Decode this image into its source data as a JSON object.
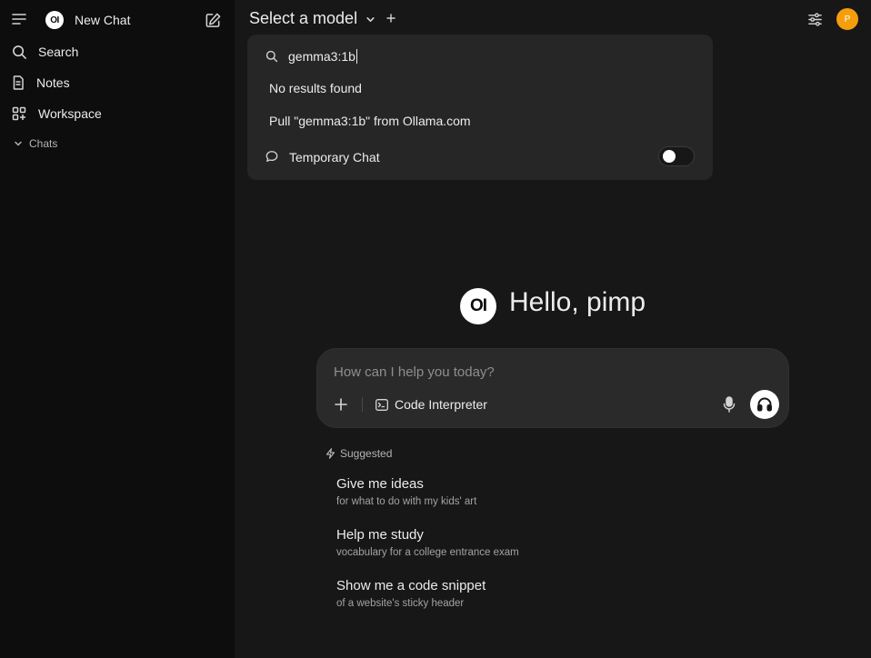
{
  "sidebar": {
    "new_chat_label": "New Chat",
    "logo_text": "OI",
    "items": [
      {
        "label": "Search",
        "icon": "search-icon"
      },
      {
        "label": "Notes",
        "icon": "notes-icon"
      },
      {
        "label": "Workspace",
        "icon": "workspace-icon"
      }
    ],
    "chats_section_label": "Chats"
  },
  "header": {
    "model_selector_label": "Select a model",
    "avatar_initial": "P"
  },
  "model_dropdown": {
    "search_value": "gemma3:1b",
    "no_results_text": "No results found",
    "pull_text": "Pull \"gemma3:1b\" from Ollama.com",
    "temporary_chat_label": "Temporary Chat",
    "temporary_chat_enabled": false
  },
  "main": {
    "logo_text": "OI",
    "greeting": "Hello, pimp",
    "prompt": {
      "placeholder": "How can I help you today?",
      "value": ""
    },
    "code_interpreter_label": "Code Interpreter",
    "suggested_label": "Suggested",
    "suggestions": [
      {
        "title": "Give me ideas",
        "subtitle": "for what to do with my kids' art"
      },
      {
        "title": "Help me study",
        "subtitle": "vocabulary for a college entrance exam"
      },
      {
        "title": "Show me a code snippet",
        "subtitle": "of a website's sticky header"
      }
    ]
  },
  "colors": {
    "sidebar_bg": "#0d0d0d",
    "main_bg": "#171717",
    "dropdown_bg": "#262626",
    "input_bg": "#2a2a2a",
    "avatar_bg": "#f59e0b"
  }
}
